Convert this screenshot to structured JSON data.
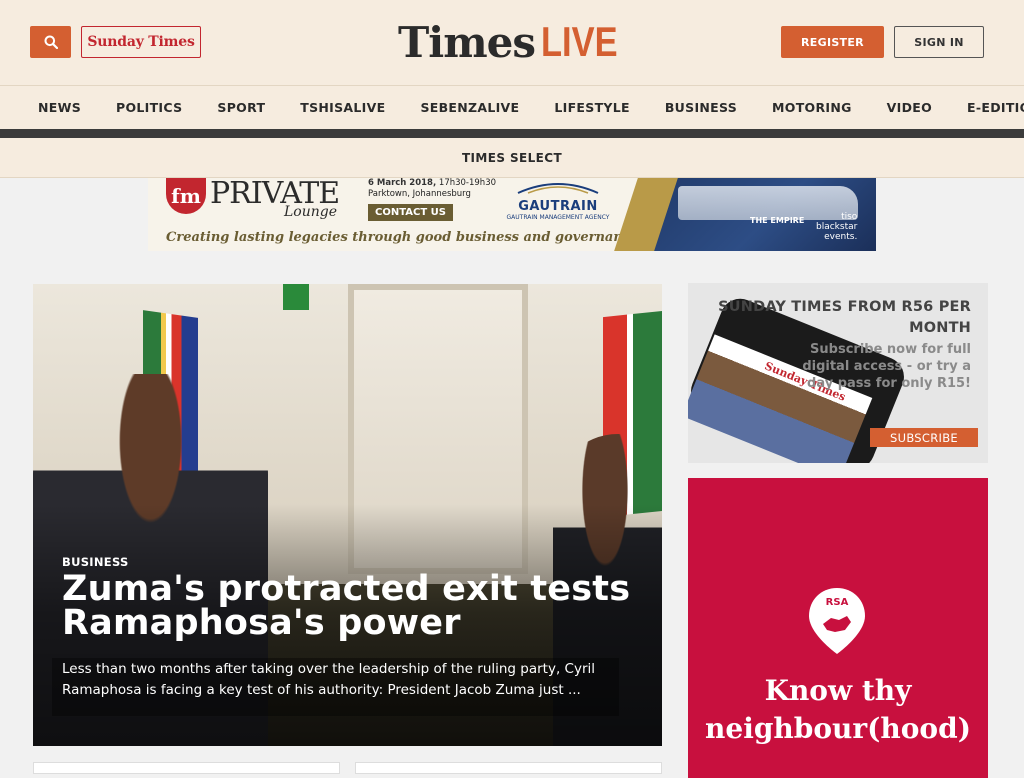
{
  "header": {
    "sunday_times_logo": "Sunday Times",
    "logo_times": "Times",
    "logo_live": "LIVE",
    "register_label": "REGISTER",
    "signin_label": "SIGN IN"
  },
  "nav": {
    "items": [
      "NEWS",
      "POLITICS",
      "SPORT",
      "TSHISALIVE",
      "SEBENZALIVE",
      "LIFESTYLE",
      "BUSINESS",
      "MOTORING",
      "VIDEO",
      "E-EDITION"
    ],
    "sub_item": "TIMES SELECT"
  },
  "banner_ad": {
    "fm": "fm",
    "private": "PRIVATE",
    "lounge": "Lounge",
    "date": "6 March 2018,",
    "time": "17h30-19h30",
    "location": "Parktown, Johannesburg",
    "contact": "CONTACT US",
    "gautrain": "GAUTRAIN",
    "gautrain_sub": "GAUTRAIN MANAGEMENT AGENCY",
    "tagline": "Creating lasting legacies through good business and governance",
    "empire": "THE EMPIRE",
    "tiso_line1": "tiso",
    "tiso_line2": "blackstar",
    "tiso_line3": "events."
  },
  "hero": {
    "kicker": "BUSINESS",
    "headline": "Zuma's protracted exit tests Ramaphosa's power",
    "lede": "Less than two months after taking over the leadership of the ruling party, Cyril Ramaphosa is facing a key test of his authority: President Jacob Zuma just ..."
  },
  "subscribe": {
    "title": "SUNDAY TIMES FROM R56 PER MONTH",
    "desc": "Subscribe now for full digital access - or try a day pass for only R15!",
    "button": "SUBSCRIBE",
    "screen_logo": "Sunday Times"
  },
  "rsa_promo": {
    "pin_label": "RSA",
    "title": "Know thy neighbour(hood)"
  },
  "colors": {
    "accent": "#d45f31",
    "header_bg": "#f6ecdf",
    "promo_red": "#c8103e"
  }
}
